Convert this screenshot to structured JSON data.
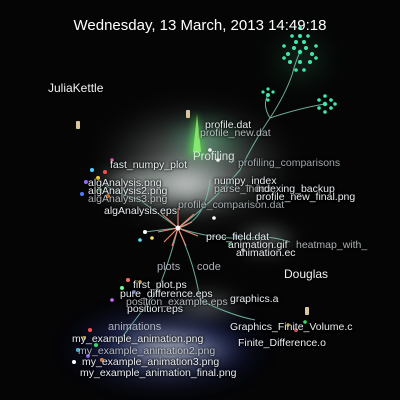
{
  "timestamp": "Wednesday, 13 March, 2013 14:49:18",
  "users": [
    "JuliaKettle",
    "Douglas"
  ],
  "directories": [
    "Profiling",
    "plots",
    "code",
    "animations"
  ],
  "files": [
    "profile.dat",
    "profile_new.dat",
    "profiling_comparisons",
    "fast_numpy_plot",
    "numpy_index",
    "parse_index",
    "indexing_backup",
    "profile_new_final.png",
    "algAnalysis.png",
    "algAnalysis2.png",
    "algAnalysis3.png",
    "algAnalysis.eps",
    "profile_comparison.dat",
    "proc_field.dat",
    "animation.gif",
    "heatmap_with_",
    "animation.ec",
    "first_plot.ps",
    "pure_difference.eps",
    "position.eps",
    "position_example.eps",
    "graphics.a",
    "Graphics_Finite_Volume.c",
    "Finite_Difference.o",
    "my_example_animation.png",
    "my_example_animation2.png",
    "my_example_animation_final.png",
    "my_example_animation3.png"
  ],
  "colors": {
    "background": "#050505",
    "edge": "#7fc8b4",
    "timestamp_text": "#ffffff",
    "label_text": "#e8ecef",
    "glow_white": "#ffffff",
    "glow_green": "#2ee88a",
    "glow_blue": "#1b2fff",
    "teal_cluster": "#3ee8b0",
    "profiling_beam": "#4ef03a",
    "center_burst": "#ff7a6a"
  }
}
